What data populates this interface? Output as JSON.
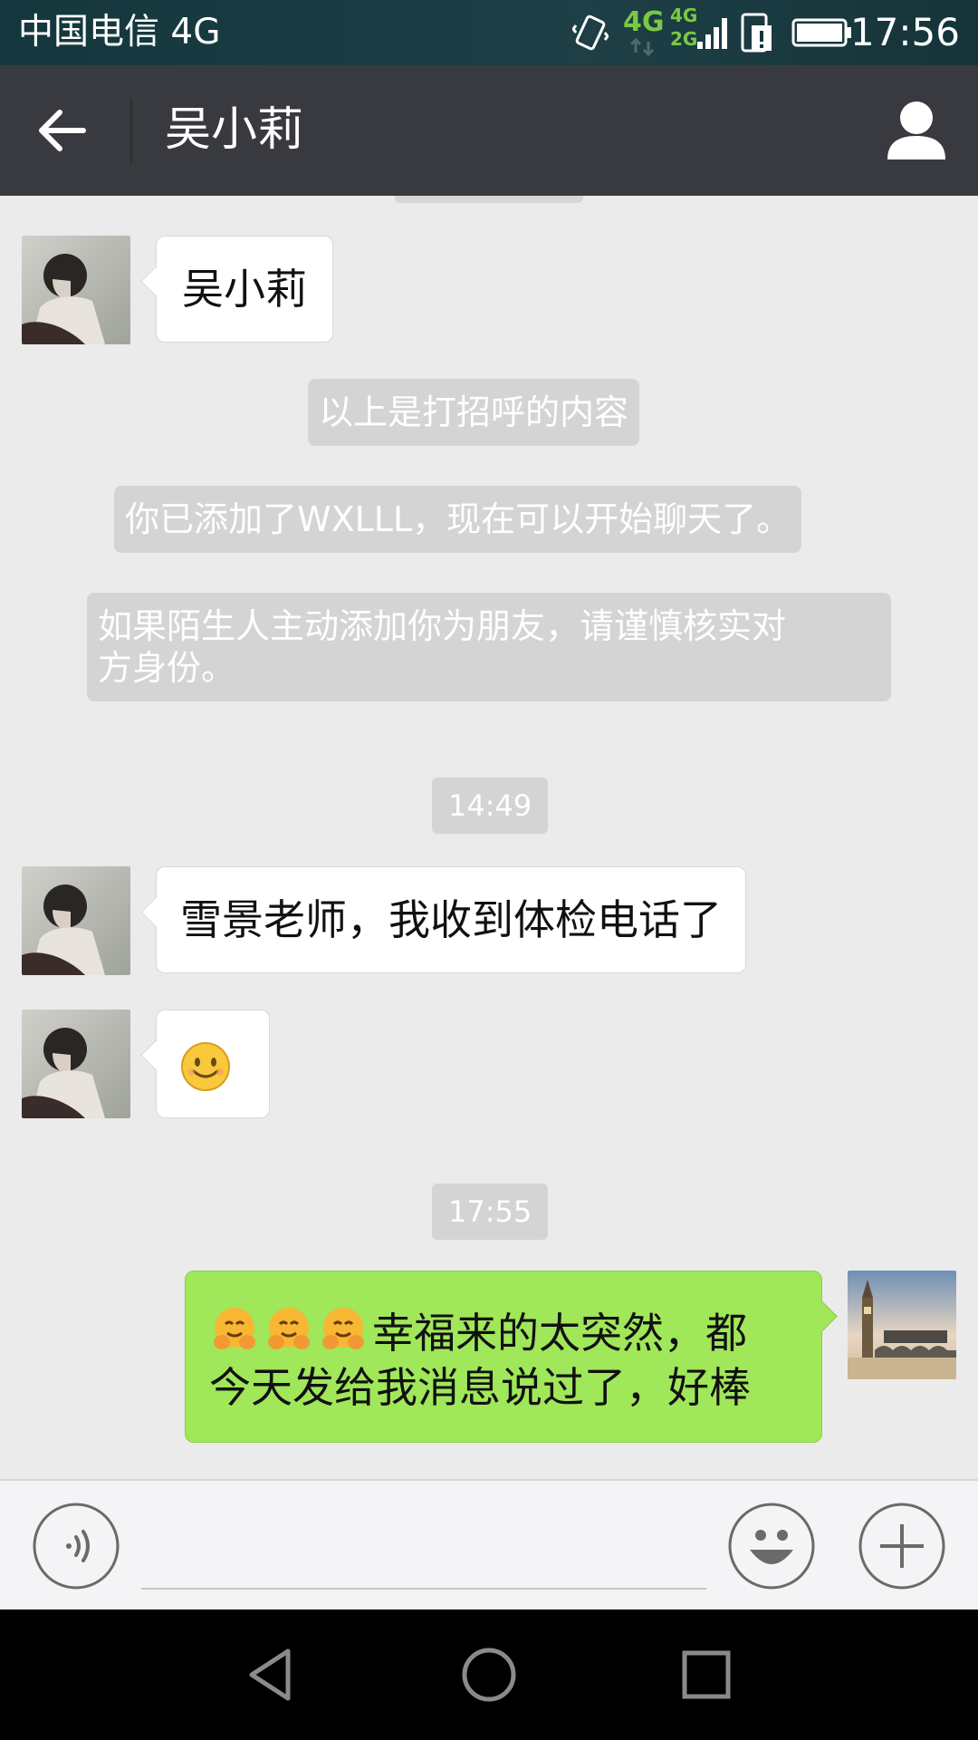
{
  "status_bar": {
    "carrier": "中国电信 4G",
    "net_top": "4G",
    "net_mini_top": "4G",
    "net_mini_bottom": "2G",
    "time": "17:56"
  },
  "header": {
    "title": "吴小莉"
  },
  "messages": {
    "greeting": "吴小莉",
    "sys_greeting_note": "以上是打招呼的内容",
    "sys_added": "你已添加了WXLLL，现在可以开始聊天了。",
    "sys_warning_line1": "如果陌生人主动添加你为朋友，请谨慎核实对",
    "sys_warning_line2": "方身份。",
    "time_1": "14:49",
    "msg_1": "雪景老师，我收到体检电话了",
    "time_2": "17:55",
    "mine_line1": "幸福来的太突然，都",
    "mine_line2": "今天发给我消息说过了，好棒"
  },
  "input": {
    "value": ""
  },
  "colors": {
    "titlebar": "#393a3f",
    "my_bubble": "#a0e75a",
    "chat_background": "#ebebeb",
    "system_bubble": "#d4d4d4"
  },
  "icons": {
    "back": "arrow-left-icon",
    "profile": "person-icon",
    "voice": "voice-icon",
    "emoji": "smiley-icon",
    "more": "plus-icon",
    "nav_back": "triangle-back-icon",
    "nav_home": "circle-home-icon",
    "nav_recents": "square-recents-icon"
  }
}
